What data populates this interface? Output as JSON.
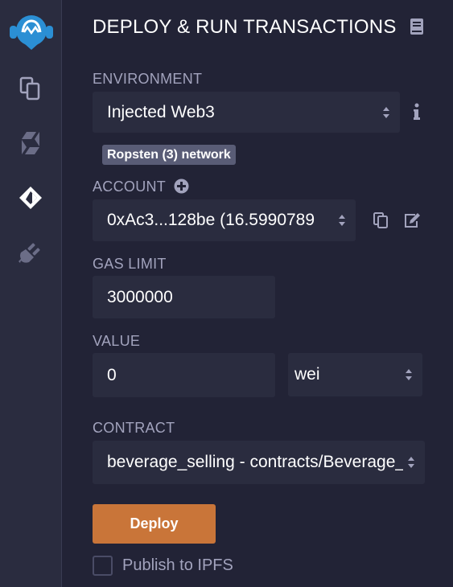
{
  "iconbar": {
    "items": [
      {
        "icon": "remix-logo-icon"
      },
      {
        "icon": "file-explorer-icon"
      },
      {
        "icon": "solidity-compiler-icon"
      },
      {
        "icon": "deploy-run-icon",
        "active": true
      },
      {
        "icon": "plugin-manager-icon"
      }
    ]
  },
  "header": {
    "title": "DEPLOY & RUN TRANSACTIONS",
    "doc_icon": "book-icon"
  },
  "environment": {
    "label": "ENVIRONMENT",
    "value": "Injected Web3",
    "network_badge": "Ropsten (3) network",
    "info_icon": "info-icon"
  },
  "account": {
    "label": "ACCOUNT",
    "value": "0xAc3...128be (16.5990789",
    "add_icon": "plus-circle-icon",
    "copy_icon": "copy-icon",
    "edit_icon": "edit-icon"
  },
  "gas_limit": {
    "label": "GAS LIMIT",
    "value": "3000000"
  },
  "value": {
    "label": "VALUE",
    "amount": "0",
    "unit": "wei"
  },
  "contract": {
    "label": "CONTRACT",
    "value": "beverage_selling - contracts/Beverage_"
  },
  "deploy_button": {
    "label": "Deploy"
  },
  "publish": {
    "label": "Publish to IPFS",
    "checked": false
  },
  "colors": {
    "background": "#222336",
    "input": "#2a2c3f",
    "accent": "#c97539",
    "badge": "#595c76"
  }
}
